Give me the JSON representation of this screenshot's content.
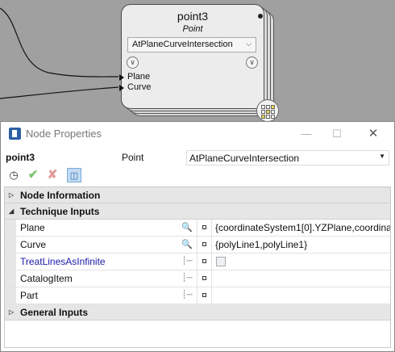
{
  "node": {
    "title": "point3",
    "subtitle": "Point",
    "method": "AtPlaneCurveIntersection",
    "ports": [
      "Plane",
      "Curve"
    ]
  },
  "dialog": {
    "title": "Node Properties",
    "header": {
      "name": "point3",
      "type": "Point",
      "method": "AtPlaneCurveIntersection"
    },
    "sections": {
      "node_information": "Node Information",
      "technique_inputs": "Technique Inputs",
      "general_inputs": "General Inputs"
    },
    "rows": [
      {
        "name": "Plane",
        "value": "{coordinateSystem1[0].YZPlane,coordinat"
      },
      {
        "name": "Curve",
        "value": "{polyLine1,polyLine1}"
      },
      {
        "name": "TreatLinesAsInfinite",
        "value": ""
      },
      {
        "name": "CatalogItem",
        "value": ""
      },
      {
        "name": "Part",
        "value": ""
      }
    ]
  }
}
